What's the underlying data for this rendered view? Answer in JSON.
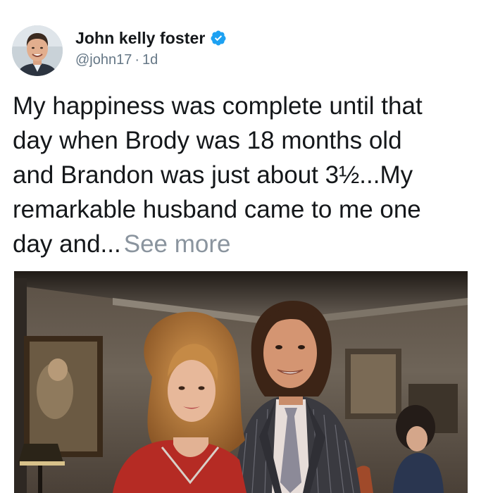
{
  "tweet": {
    "author": {
      "display_name": "John kelly foster",
      "handle": "@john17",
      "verified": true,
      "avatar_icon": "profile-photo"
    },
    "time_separator": "·",
    "timestamp": "1d",
    "text_lines": [
      "My happiness was complete until that",
      "day when Brody was 18 months old",
      "and Brandon was just about 3½...My",
      "remarkable husband came to me one",
      "day and..."
    ],
    "see_more_label": "See more",
    "media": {
      "type": "photo"
    }
  },
  "colors": {
    "verified_blue": "#1da1f2",
    "link_gray": "#8a949e",
    "meta_gray": "#657786",
    "text": "#14171a"
  }
}
